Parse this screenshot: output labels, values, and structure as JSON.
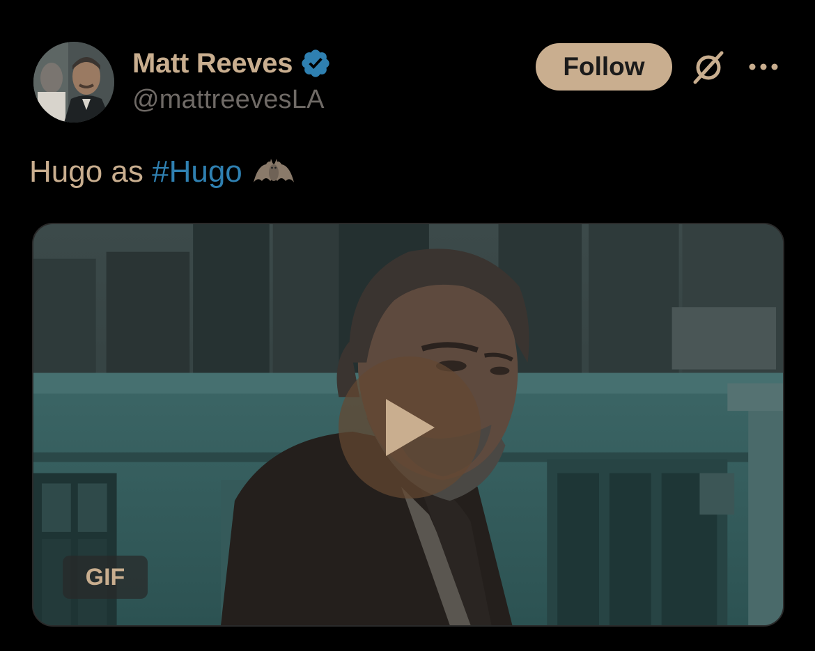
{
  "author": {
    "display_name": "Matt Reeves",
    "handle": "@mattreevesLA",
    "verified": true,
    "avatar_icon": "profile-photo"
  },
  "actions": {
    "follow_label": "Follow",
    "grok_icon": "grok-icon",
    "more_icon": "more-options-icon"
  },
  "tweet": {
    "text_plain": "Hugo as ",
    "hashtag": "#Hugo",
    "emoji": "bat-emoji"
  },
  "media": {
    "badge": "GIF",
    "play_icon": "play-icon"
  },
  "colors": {
    "background": "#000000",
    "accent": "#c9ae8f",
    "hashtag": "#2f80b1",
    "verified": "#2f80b1",
    "handle": "#6f6a66"
  }
}
